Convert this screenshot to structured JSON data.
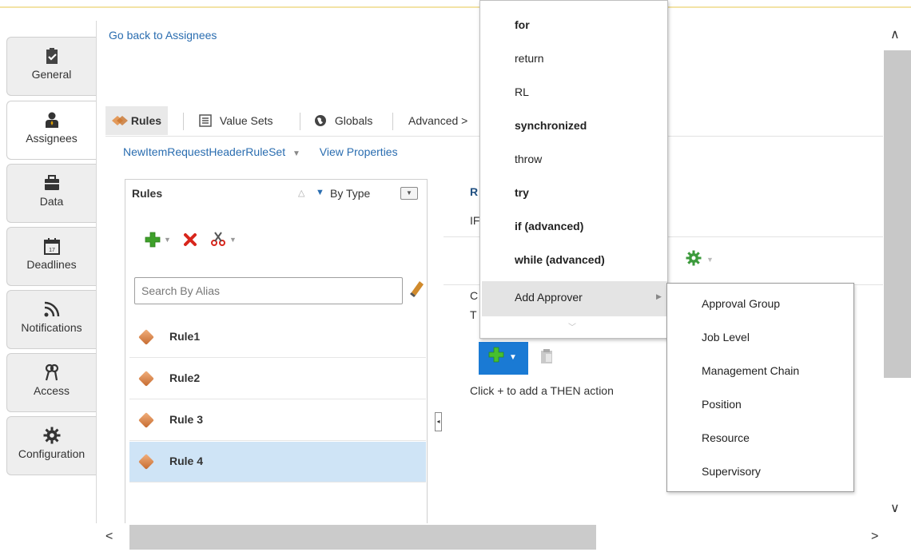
{
  "nav": {
    "go_back": "Go back to Assignees",
    "vtabs": [
      "General",
      "Assignees",
      "Data",
      "Deadlines",
      "Notifications",
      "Access",
      "Configuration"
    ]
  },
  "tabs": {
    "rules": "Rules",
    "value_sets": "Value Sets",
    "globals": "Globals",
    "advanced": "Advanced >"
  },
  "subbar": {
    "ruleset": "NewItemRequestHeaderRuleSet",
    "view_properties": "View Properties"
  },
  "rules_panel": {
    "title": "Rules",
    "sort_label": "By Type",
    "search_placeholder": "Search By Alias",
    "rules": [
      "Rule1",
      "Rule2",
      "Rule 3",
      "Rule 4"
    ],
    "selected": "Rule 4"
  },
  "rule_editor": {
    "header_partial": "R",
    "if_partial": "IF",
    "c_partial": "C",
    "t_partial": "T",
    "then_hint": "Click + to add a THEN action"
  },
  "menu": {
    "items": [
      {
        "label": "for",
        "bold": true
      },
      {
        "label": "return",
        "bold": false
      },
      {
        "label": "RL",
        "bold": false
      },
      {
        "label": "synchronized",
        "bold": true
      },
      {
        "label": "throw",
        "bold": false
      },
      {
        "label": "try",
        "bold": true
      },
      {
        "label": "if (advanced)",
        "bold": true
      },
      {
        "label": "while (advanced)",
        "bold": true
      }
    ],
    "add_approver": "Add Approver",
    "submenu": [
      "Approval Group",
      "Job Level",
      "Management Chain",
      "Position",
      "Resource",
      "Supervisory"
    ]
  },
  "colors": {
    "link": "#2a6db0",
    "selected_row": "#cfe4f6",
    "blue_button": "#1a7ad4"
  },
  "icons": [
    "checklist-icon",
    "person-icon",
    "briefcase-icon",
    "calendar-icon",
    "rss-icon",
    "keys-icon",
    "gear-icon",
    "plus-icon",
    "delete-x-icon",
    "scissors-icon",
    "eraser-icon",
    "diamond-icon",
    "clipboard-icon"
  ]
}
